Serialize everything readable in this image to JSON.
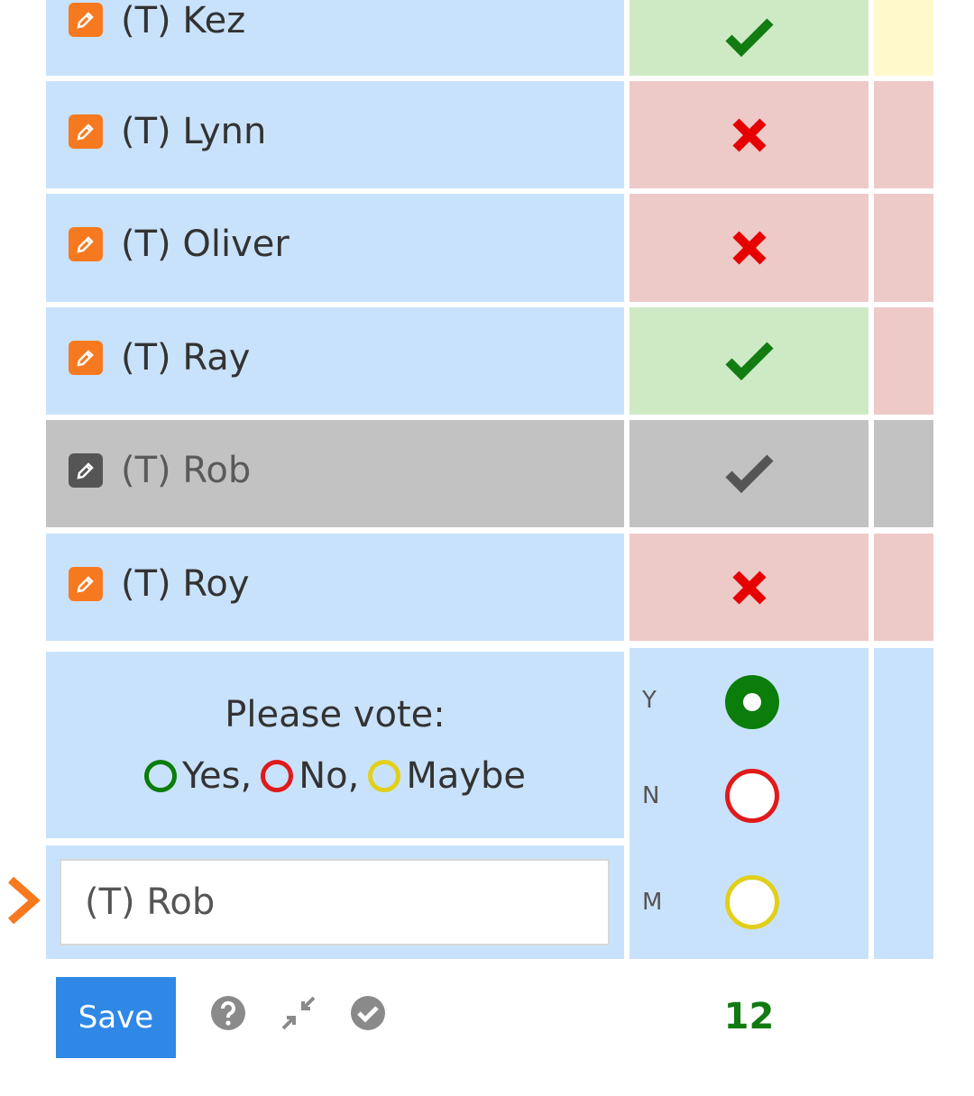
{
  "participants": [
    {
      "name": "(T) Kez",
      "vote": "yes"
    },
    {
      "name": "(T) Lynn",
      "vote": "no"
    },
    {
      "name": "(T) Oliver",
      "vote": "no"
    },
    {
      "name": "(T) Ray",
      "vote": "yes"
    },
    {
      "name": "(T) Rob",
      "vote": "yes",
      "editing": true
    },
    {
      "name": "(T) Roy",
      "vote": "no"
    }
  ],
  "vote_prompt": {
    "title": "Please vote:",
    "yes_label": "Yes,",
    "no_label": "No,",
    "maybe_label": "Maybe"
  },
  "vote_options": [
    {
      "key": "Y",
      "selected": true,
      "color": "#0a7d0a"
    },
    {
      "key": "N",
      "selected": false,
      "color": "#e01a1a"
    },
    {
      "key": "M",
      "selected": false,
      "color": "#e1cf1a"
    }
  ],
  "name_input": {
    "value": "(T) Rob"
  },
  "toolbar": {
    "save_label": "Save",
    "icons": [
      "help-icon",
      "collapse-icon",
      "check-circle-icon"
    ]
  },
  "yes_count": "12",
  "colors": {
    "row_blue": "#c9e2fb",
    "yes_green": "#cdeac5",
    "no_red": "#edc9c8",
    "maybe_yellow": "#fff9cc",
    "editing_grey": "#c2c2c2",
    "edit_orange": "#f7791f",
    "accent_blue": "#2f88e5"
  }
}
